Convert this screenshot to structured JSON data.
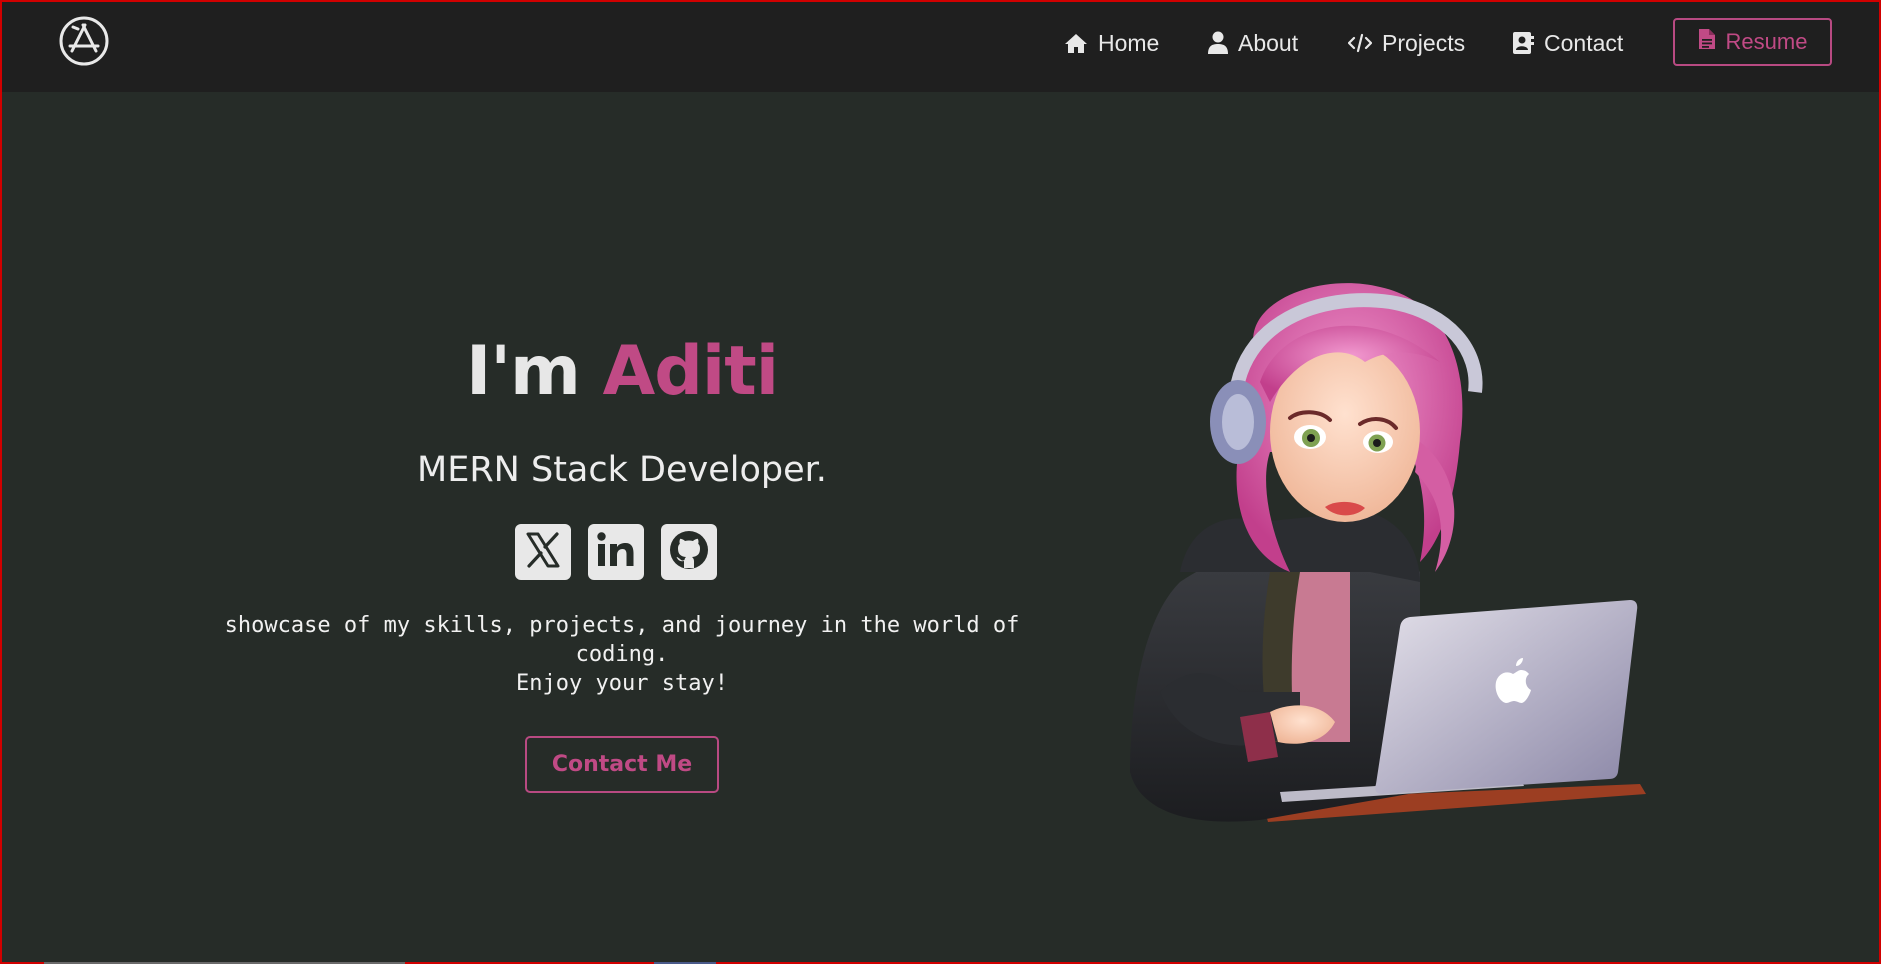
{
  "nav": {
    "logo": "app-store-icon",
    "items": [
      {
        "label": "Home",
        "icon": "home-icon"
      },
      {
        "label": "About",
        "icon": "user-icon"
      },
      {
        "label": "Projects",
        "icon": "code-icon"
      },
      {
        "label": "Contact",
        "icon": "contact-card-icon"
      }
    ],
    "resume_label": "Resume"
  },
  "hero": {
    "greeting": "I'm",
    "name": "Aditi",
    "role": "MERN Stack Developer.",
    "socials": [
      "x-icon",
      "linkedin-icon",
      "github-icon"
    ],
    "tagline_line1": "showcase of my skills, projects, and journey in the world of",
    "tagline_line2": "coding.",
    "tagline_line3": "Enjoy your stay!",
    "contact_label": "Contact Me"
  },
  "colors": {
    "accent": "#c04a85",
    "background": "#262c28",
    "navbar": "#1f1f1f",
    "text": "#e7e7e7"
  }
}
